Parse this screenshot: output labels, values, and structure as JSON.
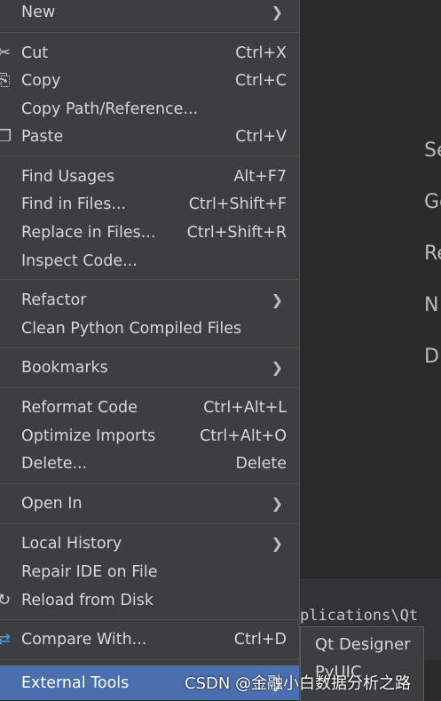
{
  "editor": {
    "hints": [
      "Se",
      "Go",
      "Re",
      "N",
      "D"
    ],
    "path_text": "plications\\Qt"
  },
  "menu": {
    "items": [
      {
        "label": "New",
        "shortcut": "",
        "submenu": true
      },
      {
        "label": "Cut",
        "shortcut": "Ctrl+X",
        "icon": "scissors-icon"
      },
      {
        "label": "Copy",
        "shortcut": "Ctrl+C",
        "icon": "copy-icon"
      },
      {
        "label": "Copy Path/Reference...",
        "shortcut": ""
      },
      {
        "label": "Paste",
        "shortcut": "Ctrl+V",
        "icon": "paste-icon"
      },
      {
        "label": "Find Usages",
        "shortcut": "Alt+F7"
      },
      {
        "label": "Find in Files...",
        "shortcut": "Ctrl+Shift+F"
      },
      {
        "label": "Replace in Files...",
        "shortcut": "Ctrl+Shift+R"
      },
      {
        "label": "Inspect Code...",
        "shortcut": ""
      },
      {
        "label": "Refactor",
        "shortcut": "",
        "submenu": true
      },
      {
        "label": "Clean Python Compiled Files",
        "shortcut": ""
      },
      {
        "label": "Bookmarks",
        "shortcut": "",
        "submenu": true
      },
      {
        "label": "Reformat Code",
        "shortcut": "Ctrl+Alt+L"
      },
      {
        "label": "Optimize Imports",
        "shortcut": "Ctrl+Alt+O"
      },
      {
        "label": "Delete...",
        "shortcut": "Delete"
      },
      {
        "label": "Open In",
        "shortcut": "",
        "submenu": true
      },
      {
        "label": "Local History",
        "shortcut": "",
        "submenu": true
      },
      {
        "label": "Repair IDE on File",
        "shortcut": ""
      },
      {
        "label": "Reload from Disk",
        "shortcut": "",
        "icon": "reload-icon"
      },
      {
        "label": "Compare With...",
        "shortcut": "Ctrl+D",
        "icon": "compare-icon"
      },
      {
        "label": "External Tools",
        "shortcut": "",
        "submenu": true,
        "selected": true
      }
    ]
  },
  "submenu": {
    "items": [
      "Qt Designer",
      "PyUIC"
    ]
  },
  "watermark": "CSDN @金融小白数据分析之路",
  "colors": {
    "menu_bg": "#3c3f41",
    "selected_bg": "#4b6eaf",
    "text": "#d6d6d6"
  }
}
